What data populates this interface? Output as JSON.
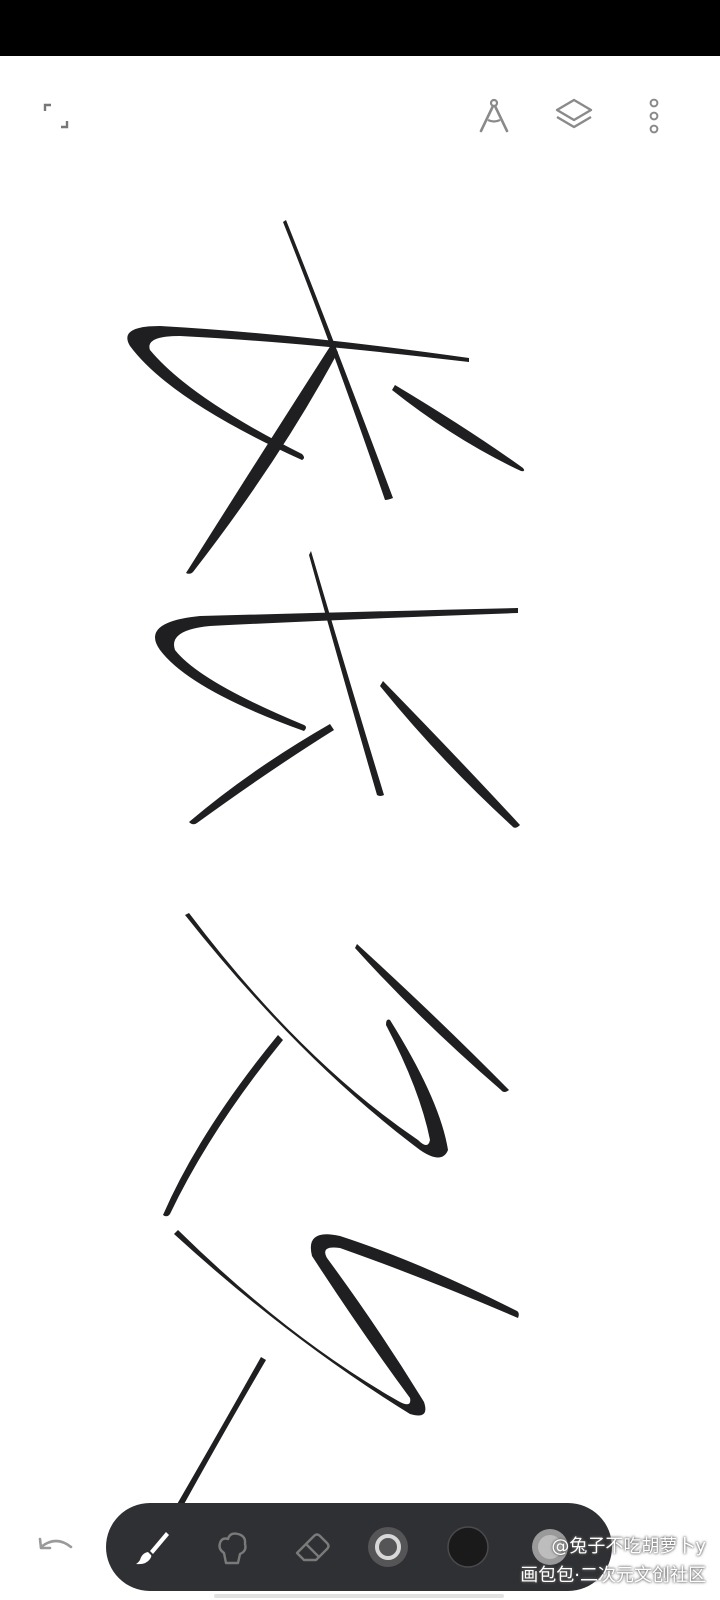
{
  "watermark": {
    "line1": "@兔子不吃胡萝卜y",
    "line2": "画包包·二次元文创社区"
  },
  "icons": {
    "fullscreen": "fullscreen-icon",
    "compass": "compass-icon",
    "layers": "layers-icon",
    "more": "more-vert-icon",
    "undo": "undo-icon",
    "brush": "brush-icon",
    "smudge": "smudge-icon",
    "eraser": "eraser-icon",
    "brush_size": "brush-size-icon",
    "color": "color-swatch",
    "opacity": "opacity-icon"
  },
  "colors": {
    "canvas": "#ffffff",
    "ink": "#1f1f21",
    "toolbar": "#2f3033",
    "current_color": "#1a1a1a"
  }
}
